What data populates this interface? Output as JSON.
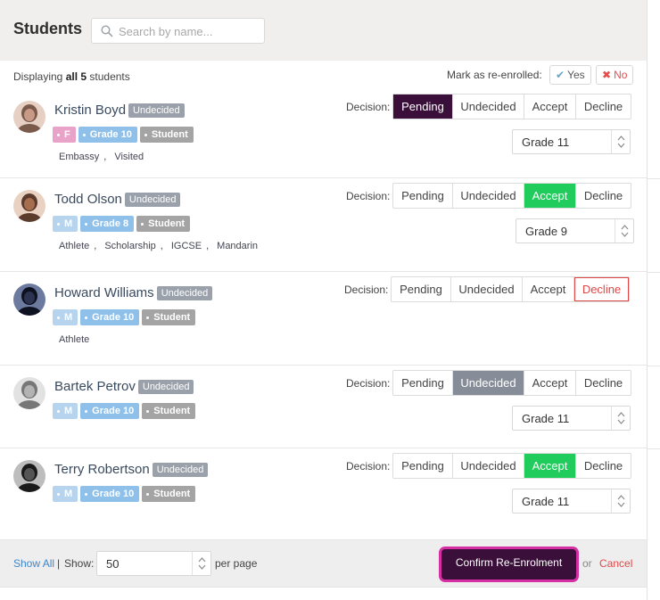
{
  "header": {
    "title": "Students",
    "search_placeholder": "Search by name..."
  },
  "summary": {
    "prefix": "Displaying",
    "count_text": "all 5",
    "suffix": "students"
  },
  "mark_reenrolled": {
    "label": "Mark as re-enrolled:",
    "yes_label": "Yes",
    "no_label": "No"
  },
  "decision_label": "Decision:",
  "decision_options": [
    "Pending",
    "Undecided",
    "Accept",
    "Decline"
  ],
  "students": [
    {
      "name": "Kristin Boyd",
      "status": "Undecided",
      "gender": "F",
      "grade": "Grade 10",
      "role": "Student",
      "categories": [
        "Embassy",
        "Visited"
      ],
      "decision": "Pending",
      "next_grade": "Grade 11"
    },
    {
      "name": "Todd Olson",
      "status": "Undecided",
      "gender": "M",
      "grade": "Grade 8",
      "role": "Student",
      "categories": [
        "Athlete",
        "Scholarship",
        "IGCSE",
        "Mandarin"
      ],
      "decision": "Accept",
      "next_grade": "Grade 9"
    },
    {
      "name": "Howard Williams",
      "status": "Undecided",
      "gender": "M",
      "grade": "Grade 10",
      "role": "Student",
      "categories": [
        "Athlete"
      ],
      "decision": "Decline",
      "next_grade": ""
    },
    {
      "name": "Bartek Petrov",
      "status": "Undecided",
      "gender": "M",
      "grade": "Grade 10",
      "role": "Student",
      "categories": [],
      "decision": "Undecided",
      "next_grade": "Grade 11"
    },
    {
      "name": "Terry Robertson",
      "status": "Undecided",
      "gender": "M",
      "grade": "Grade 10",
      "role": "Student",
      "categories": [],
      "decision": "Accept",
      "next_grade": "Grade 11"
    }
  ],
  "footer": {
    "show_all": "Show All",
    "pipe": "|",
    "show_label": "Show:",
    "per_page_value": "50",
    "per_page_label": "per page",
    "confirm_label": "Confirm Re-Enrolment",
    "or_label": "or",
    "cancel_label": "Cancel"
  },
  "colors": {
    "pending_active": "#3a0f3a",
    "undecided_active": "#868d99",
    "accept_active": "#1fcc5c",
    "decline_active": "#e04848",
    "confirm_glow": "#d62ea3",
    "link": "#3f86c9"
  }
}
